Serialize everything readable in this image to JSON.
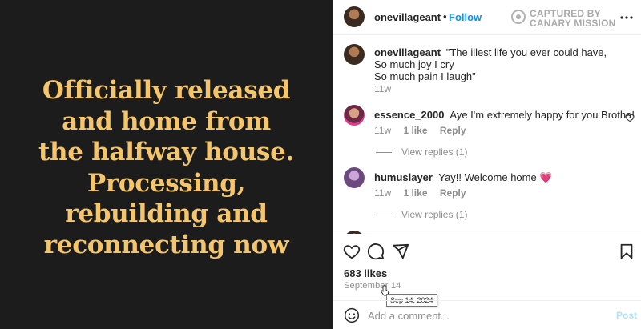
{
  "post_image": {
    "lines": [
      "Officially released",
      "and home from",
      "the halfway house.",
      "Processing,",
      "rebuilding and",
      "reconnecting now"
    ],
    "text_color": "#f4c56a",
    "background_color": "#1c1c1c"
  },
  "header": {
    "username": "onevillageant",
    "separator": "•",
    "follow_label": "Follow",
    "watermark_line1": "CAPTURED BY",
    "watermark_line2": "CANARY MISSION",
    "more_icon": "more-horizontal-icon"
  },
  "caption": {
    "username": "onevillageant",
    "lines": [
      "\"The illest life you ever could have,",
      "So much joy I cry",
      "So much pain I laugh\""
    ],
    "time": "11w"
  },
  "comments": [
    {
      "username": "essence_2000",
      "text": "Aye I'm extremely happy for you Brotha!",
      "time": "11w",
      "likes": "1 like",
      "reply_label": "Reply",
      "view_replies": "View replies (1)"
    },
    {
      "username": "humuslayer",
      "text": "Yay!! Welcome home 💗",
      "time": "11w",
      "likes": "1 like",
      "reply_label": "Reply",
      "view_replies": "View replies (1)"
    }
  ],
  "actions": {
    "icons": [
      "heart-icon",
      "comment-icon",
      "share-icon",
      "bookmark-icon"
    ]
  },
  "likes_text": "683 likes",
  "date_text": "September 14",
  "tooltip_text": "Sep 14, 2024",
  "comment_bar": {
    "placeholder": "Add a comment...",
    "post_label": "Post"
  },
  "colors": {
    "link_blue": "#0095f6",
    "post_disabled": "#b2dffc",
    "muted": "#8e8e8e"
  }
}
